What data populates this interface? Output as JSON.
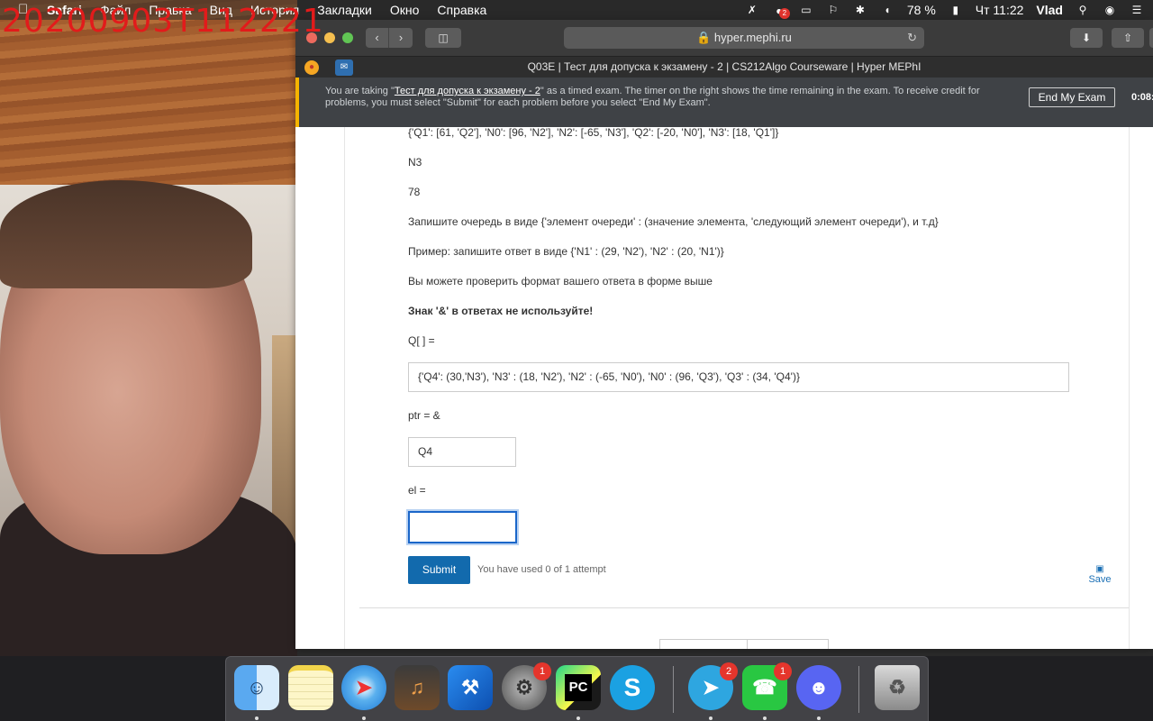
{
  "overlay": {
    "timestamp": "20200903T112221"
  },
  "menubar": {
    "app_name": "Safari",
    "menus": [
      "Файл",
      "Правка",
      "Вид",
      "История",
      "Закладки",
      "Окно",
      "Справка"
    ],
    "notification_badge": "2",
    "battery": "78 %",
    "clock": "Чт 11:22",
    "user": "Vlad"
  },
  "browser": {
    "url": "hyper.mephi.ru",
    "tab_title": "Q03E | Тест для допуска к экзамену - 2 | CS212Algo Courseware | Hyper MEPhI"
  },
  "exam_banner": {
    "text_before": "You are taking \"",
    "exam_name": "Тест для допуска к экзамену - 2",
    "text_after": "\" as a timed exam. The timer on the right shows the time remaining in the exam. To receive credit for problems, you must select \"Submit\" for each problem before you select \"End My Exam\".",
    "end_button": "End My Exam",
    "timer": "0:08:"
  },
  "problem": {
    "queue_dict": "{'Q1': [61, 'Q2'], 'N0': [96, 'N2'], 'N2': [-65, 'N3'], 'Q2': [-20, 'N0'], 'N3': [18, 'Q1']}",
    "ptr_value": "N3",
    "el_value": "78",
    "instruction": "Запишите очередь в виде {'элемент очереди' : (значение элемента, 'следующий элемент очереди'), и т.д}",
    "example": "Пример: запишите ответ в виде {'N1' : (29, 'N2'), 'N2' : (20, 'N1')}",
    "check_hint": "Вы можете проверить формат вашего ответа в форме выше",
    "warning": "Знак '&' в ответах не используйте!",
    "q_label": "Q[ ] =",
    "q_answer": "{'Q4': (30,'N3'), 'N3' : (18, 'N2'), 'N2' : (-65, 'N0'), 'N0' : (96, 'Q3'), 'Q3' : (34, 'Q4')}",
    "ptr_label": "ptr = &",
    "ptr_answer": "Q4",
    "el_label": "el =",
    "el_answer": "",
    "submit_label": "Submit",
    "attempts_text": "You have used 0 of 1 attempt",
    "save_label": "Save"
  },
  "dock": {
    "items": [
      {
        "name": "Finder"
      },
      {
        "name": "Notes"
      },
      {
        "name": "Safari"
      },
      {
        "name": "GarageBand"
      },
      {
        "name": "Xcode"
      },
      {
        "name": "System Preferences",
        "badge": "1"
      },
      {
        "name": "PyCharm",
        "label": "PC"
      },
      {
        "name": "Skype",
        "label": "S"
      },
      {
        "name": "Telegram",
        "badge": "2"
      },
      {
        "name": "FaceTime",
        "badge": "1"
      },
      {
        "name": "Discord"
      },
      {
        "name": "Trash"
      }
    ]
  },
  "colors": {
    "accent": "#126aad",
    "banner_bg": "#3f4246",
    "banner_accent": "#f5b400",
    "timestamp": "#e21b1b"
  }
}
